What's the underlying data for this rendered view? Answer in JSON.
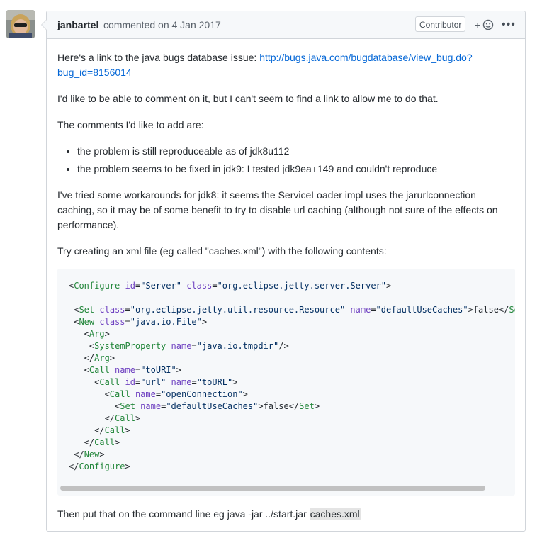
{
  "comment": {
    "author": "janbartel",
    "meta": "commented on 4 Jan 2017",
    "badge": "Contributor",
    "reaction_plus": "+",
    "more": "•••",
    "p1_text": "Here's a link to the java bugs database issue: ",
    "p1_link": "http://bugs.java.com/bugdatabase/view_bug.do?bug_id=8156014",
    "p2": "I'd like to be able to comment on it, but I can't seem to find a link to allow me to do that.",
    "p3": "The comments I'd like to add are:",
    "bullets": [
      "the problem is still reproduceable as of jdk8u112",
      "the problem seems to be fixed in jdk9: I tested jdk9ea+149 and couldn't reproduce"
    ],
    "p4": "I've tried some workarounds for jdk8: it seems the ServiceLoader impl uses the jarurlconnection caching, so it may be of some benefit to try to disable url caching (although not sure of the effects on performance).",
    "p5": "Try creating an xml file (eg called \"caches.xml\") with the following contents:",
    "p6_text": "Then put that on the command line eg java -jar ../start.jar ",
    "p6_code": "caches.xml"
  },
  "code_lines": [
    [
      [
        "p",
        "<"
      ],
      [
        "t",
        "Configure"
      ],
      [
        "p",
        " "
      ],
      [
        "a",
        "id"
      ],
      [
        "p",
        "="
      ],
      [
        "s",
        "\"Server\""
      ],
      [
        "p",
        " "
      ],
      [
        "a",
        "class"
      ],
      [
        "p",
        "="
      ],
      [
        "s",
        "\"org.eclipse.jetty.server.Server\""
      ],
      [
        "p",
        ">"
      ]
    ],
    [],
    [
      [
        "p",
        " <"
      ],
      [
        "t",
        "Set"
      ],
      [
        "p",
        " "
      ],
      [
        "a",
        "class"
      ],
      [
        "p",
        "="
      ],
      [
        "s",
        "\"org.eclipse.jetty.util.resource.Resource\""
      ],
      [
        "p",
        " "
      ],
      [
        "a",
        "name"
      ],
      [
        "p",
        "="
      ],
      [
        "s",
        "\"defaultUseCaches\""
      ],
      [
        "p",
        ">false</"
      ],
      [
        "t",
        "Set"
      ],
      [
        "p",
        ">"
      ]
    ],
    [
      [
        "p",
        " <"
      ],
      [
        "t",
        "New"
      ],
      [
        "p",
        " "
      ],
      [
        "a",
        "class"
      ],
      [
        "p",
        "="
      ],
      [
        "s",
        "\"java.io.File\""
      ],
      [
        "p",
        ">"
      ]
    ],
    [
      [
        "p",
        "   <"
      ],
      [
        "t",
        "Arg"
      ],
      [
        "p",
        ">"
      ]
    ],
    [
      [
        "p",
        "    <"
      ],
      [
        "t",
        "SystemProperty"
      ],
      [
        "p",
        " "
      ],
      [
        "a",
        "name"
      ],
      [
        "p",
        "="
      ],
      [
        "s",
        "\"java.io.tmpdir\""
      ],
      [
        "p",
        "/>"
      ]
    ],
    [
      [
        "p",
        "   </"
      ],
      [
        "t",
        "Arg"
      ],
      [
        "p",
        ">"
      ]
    ],
    [
      [
        "p",
        "   <"
      ],
      [
        "t",
        "Call"
      ],
      [
        "p",
        " "
      ],
      [
        "a",
        "name"
      ],
      [
        "p",
        "="
      ],
      [
        "s",
        "\"toURI\""
      ],
      [
        "p",
        ">"
      ]
    ],
    [
      [
        "p",
        "     <"
      ],
      [
        "t",
        "Call"
      ],
      [
        "p",
        " "
      ],
      [
        "a",
        "id"
      ],
      [
        "p",
        "="
      ],
      [
        "s",
        "\"url\""
      ],
      [
        "p",
        " "
      ],
      [
        "a",
        "name"
      ],
      [
        "p",
        "="
      ],
      [
        "s",
        "\"toURL\""
      ],
      [
        "p",
        ">"
      ]
    ],
    [
      [
        "p",
        "       <"
      ],
      [
        "t",
        "Call"
      ],
      [
        "p",
        " "
      ],
      [
        "a",
        "name"
      ],
      [
        "p",
        "="
      ],
      [
        "s",
        "\"openConnection\""
      ],
      [
        "p",
        ">"
      ]
    ],
    [
      [
        "p",
        "         <"
      ],
      [
        "t",
        "Set"
      ],
      [
        "p",
        " "
      ],
      [
        "a",
        "name"
      ],
      [
        "p",
        "="
      ],
      [
        "s",
        "\"defaultUseCaches\""
      ],
      [
        "p",
        ">false</"
      ],
      [
        "t",
        "Set"
      ],
      [
        "p",
        ">"
      ]
    ],
    [
      [
        "p",
        "       </"
      ],
      [
        "t",
        "Call"
      ],
      [
        "p",
        ">"
      ]
    ],
    [
      [
        "p",
        "     </"
      ],
      [
        "t",
        "Call"
      ],
      [
        "p",
        ">"
      ]
    ],
    [
      [
        "p",
        "   </"
      ],
      [
        "t",
        "Call"
      ],
      [
        "p",
        ">"
      ]
    ],
    [
      [
        "p",
        " </"
      ],
      [
        "t",
        "New"
      ],
      [
        "p",
        ">"
      ]
    ],
    [
      [
        "p",
        "</"
      ],
      [
        "t",
        "Configure"
      ],
      [
        "p",
        ">"
      ]
    ]
  ]
}
